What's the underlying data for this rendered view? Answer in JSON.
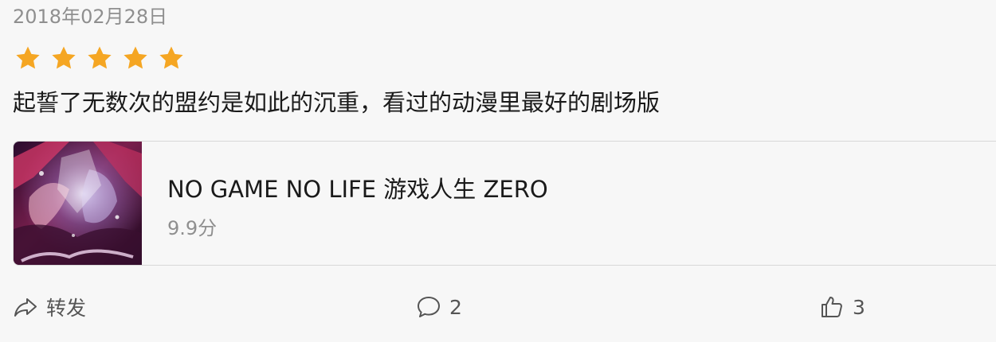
{
  "review": {
    "date": "2018年02月28日",
    "rating_stars": 5,
    "rating_max": 5,
    "star_color": "#f5a623",
    "text": "起誓了无数次的盟约是如此的沉重，看过的动漫里最好的剧场版"
  },
  "card": {
    "title": "NO GAME NO LIFE 游戏人生 ZERO",
    "score": "9.9分",
    "poster_icon": "anime-poster-image"
  },
  "actions": {
    "share_label": "转发",
    "share_icon": "share-icon",
    "comment_count": "2",
    "comment_icon": "comment-icon",
    "like_count": "3",
    "like_icon": "thumbs-up-icon"
  }
}
